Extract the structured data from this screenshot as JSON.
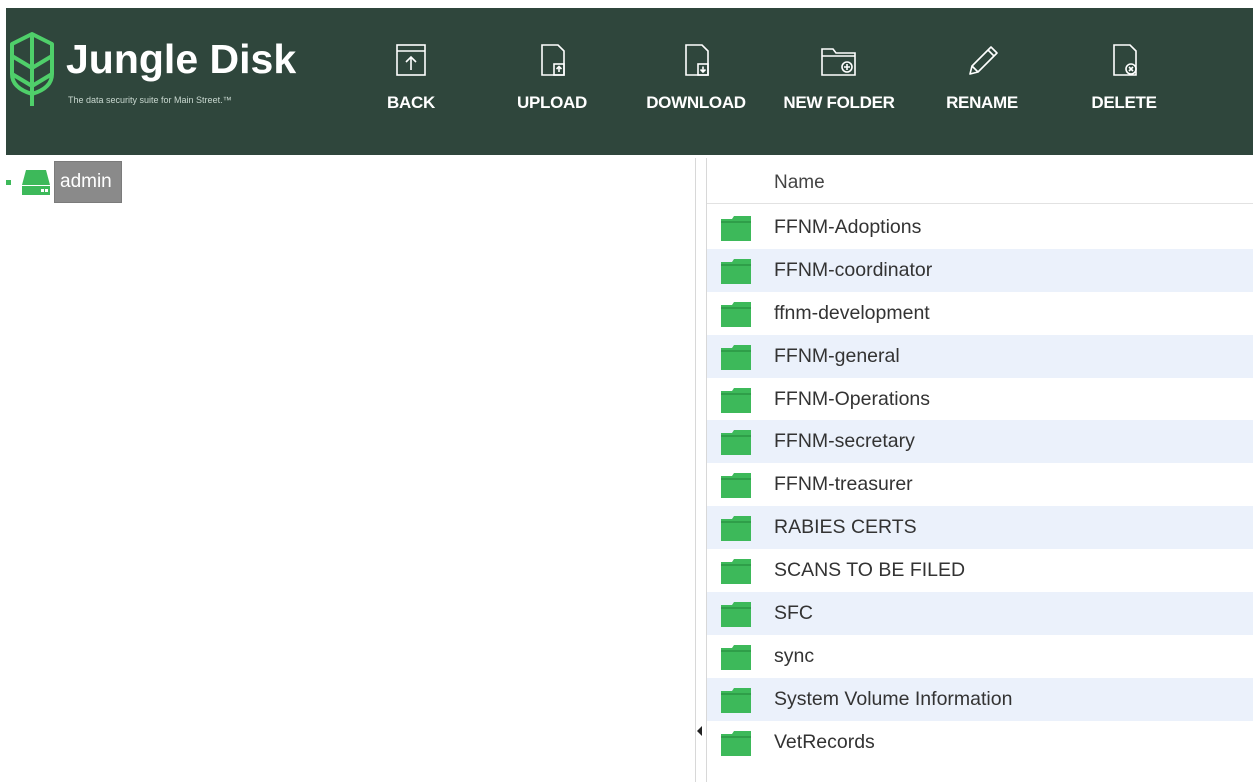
{
  "app": {
    "logo_title": "Jungle Disk",
    "logo_tagline": "The data security suite for Main Street.™",
    "brand_color": "#2f463c",
    "accent_color": "#3db95a"
  },
  "toolbar": {
    "back_label": "BACK",
    "upload_label": "UPLOAD",
    "download_label": "DOWNLOAD",
    "new_folder_label": "NEW FOLDER",
    "rename_label": "RENAME",
    "delete_label": "DELETE"
  },
  "tree": {
    "root_label": "admin",
    "root_icon": "drive-icon"
  },
  "file_list": {
    "column_header": "Name",
    "row_icon": "folder-icon",
    "items": [
      "FFNM-Adoptions",
      "FFNM-coordinator",
      "ffnm-development",
      "FFNM-general",
      "FFNM-Operations",
      "FFNM-secretary",
      "FFNM-treasurer",
      "RABIES CERTS",
      "SCANS TO BE FILED",
      "SFC",
      "sync",
      "System Volume Information",
      "VetRecords"
    ]
  }
}
